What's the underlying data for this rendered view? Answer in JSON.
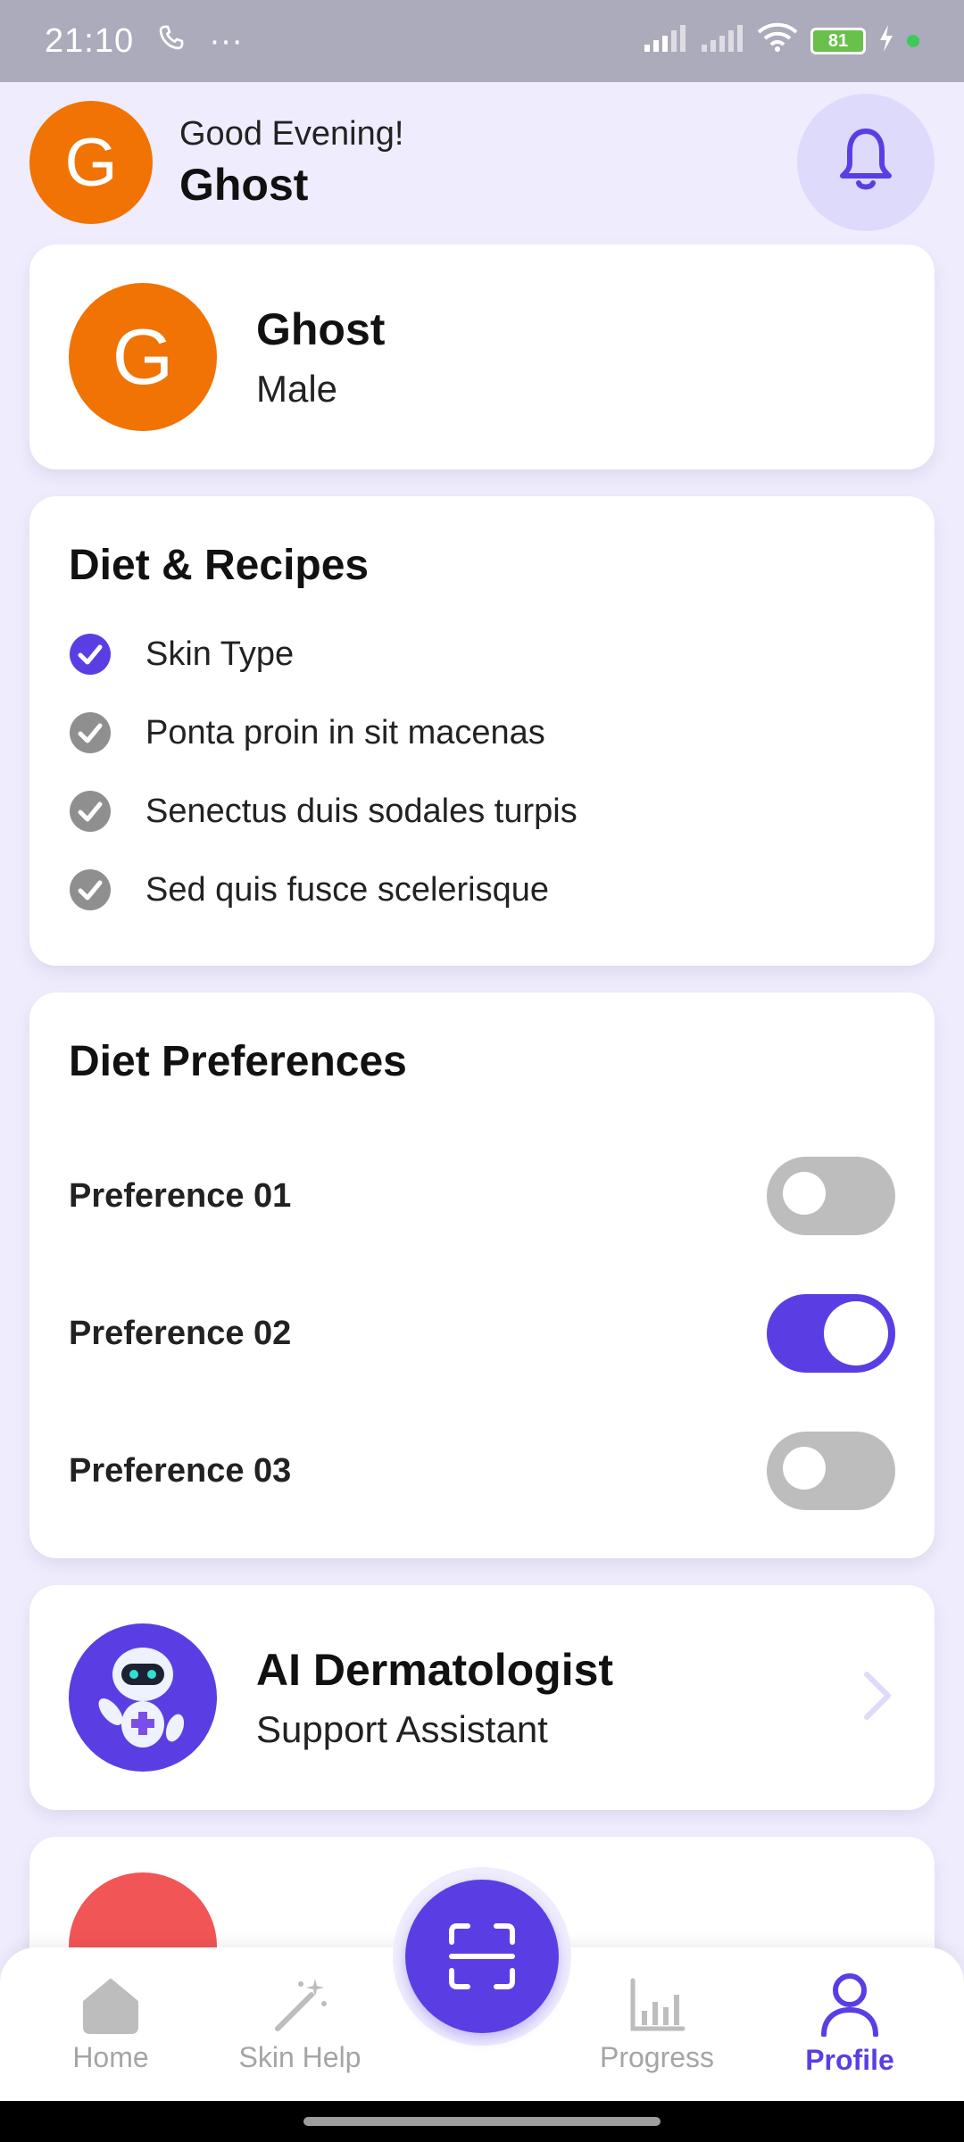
{
  "status_bar": {
    "time": "21:10",
    "more": "···",
    "battery": "81"
  },
  "header": {
    "avatar_letter": "G",
    "greeting": "Good Evening!",
    "name": "Ghost",
    "bell_icon": "bell-icon"
  },
  "profile": {
    "avatar_letter": "G",
    "name": "Ghost",
    "gender": "Male"
  },
  "diet_recipes": {
    "title": "Diet & Recipes",
    "items": [
      {
        "label": "Skin Type",
        "checked": true
      },
      {
        "label": "Ponta proin in sit macenas",
        "checked": false
      },
      {
        "label": "Senectus duis sodales turpis",
        "checked": false
      },
      {
        "label": "Sed quis fusce scelerisque",
        "checked": false
      }
    ]
  },
  "diet_preferences": {
    "title": "Diet Preferences",
    "items": [
      {
        "label": "Preference 01",
        "on": false
      },
      {
        "label": "Preference 02",
        "on": true
      },
      {
        "label": "Preference 03",
        "on": false
      }
    ]
  },
  "ai_card": {
    "title": "AI Dermatologist",
    "subtitle": "Support Assistant"
  },
  "nav": {
    "home": "Home",
    "skin_help": "Skin Help",
    "progress": "Progress",
    "profile": "Profile",
    "active": "profile"
  },
  "colors": {
    "accent": "#5b3ee3",
    "avatar": "#f07303",
    "background": "#efedfd",
    "inactive": "#a5a5a5"
  }
}
